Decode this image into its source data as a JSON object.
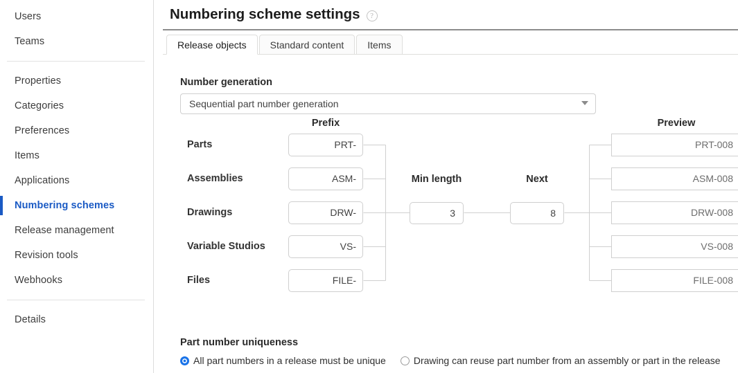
{
  "sidebar": {
    "groups": [
      {
        "items": [
          {
            "label": "Users",
            "active": false
          },
          {
            "label": "Teams",
            "active": false
          }
        ]
      },
      {
        "items": [
          {
            "label": "Properties",
            "active": false
          },
          {
            "label": "Categories",
            "active": false
          },
          {
            "label": "Preferences",
            "active": false
          },
          {
            "label": "Items",
            "active": false
          },
          {
            "label": "Applications",
            "active": false
          },
          {
            "label": "Numbering schemes",
            "active": true
          },
          {
            "label": "Release management",
            "active": false
          },
          {
            "label": "Revision tools",
            "active": false
          },
          {
            "label": "Webhooks",
            "active": false
          }
        ]
      },
      {
        "items": [
          {
            "label": "Details",
            "active": false
          }
        ]
      }
    ],
    "active_color": "#1a5ac4"
  },
  "header": {
    "title": "Numbering scheme settings",
    "help_icon": "question-circle-icon",
    "help_glyph": "?"
  },
  "tabs": [
    {
      "label": "Release objects",
      "active": true
    },
    {
      "label": "Standard content",
      "active": false
    },
    {
      "label": "Items",
      "active": false
    }
  ],
  "number_generation": {
    "label": "Number generation",
    "selected": "Sequential part number generation",
    "caret_icon": "chevron-down-icon"
  },
  "scheme": {
    "prefix_header": "Prefix",
    "preview_header": "Preview",
    "min_length_label": "Min length",
    "min_length_value": "3",
    "next_label": "Next",
    "next_value": "8",
    "rows": [
      {
        "label": "Parts",
        "prefix": "PRT-",
        "preview": "PRT-008"
      },
      {
        "label": "Assemblies",
        "prefix": "ASM-",
        "preview": "ASM-008"
      },
      {
        "label": "Drawings",
        "prefix": "DRW-",
        "preview": "DRW-008"
      },
      {
        "label": "Variable Studios",
        "prefix": "VS-",
        "preview": "VS-008"
      },
      {
        "label": "Files",
        "prefix": "FILE-",
        "preview": "FILE-008"
      }
    ]
  },
  "uniqueness": {
    "title": "Part number uniqueness",
    "options": [
      {
        "label": "All part numbers in a release must be unique",
        "selected": true
      },
      {
        "label": "Drawing can reuse part number from an assembly or part in the release",
        "selected": false
      }
    ],
    "accent_color": "#1a73e8"
  }
}
